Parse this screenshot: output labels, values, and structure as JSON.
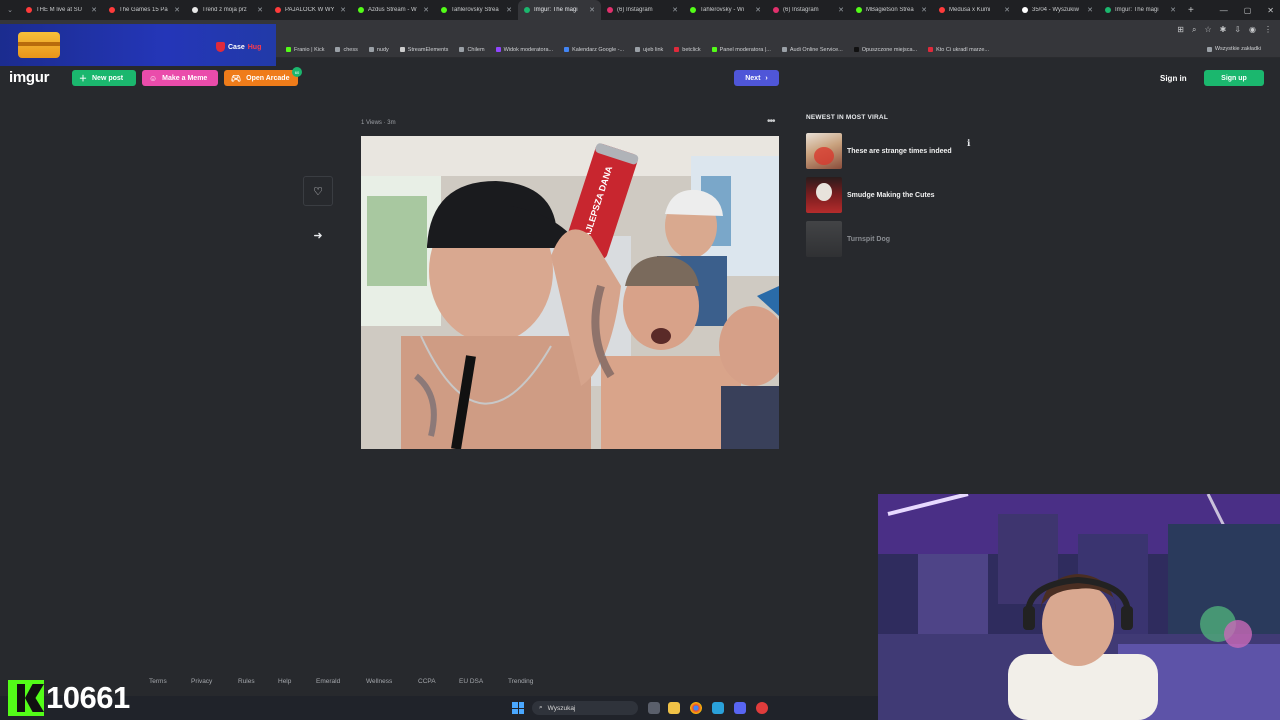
{
  "browser": {
    "tabs": [
      {
        "label": "THE M live at SU",
        "color": "#ff3b3b",
        "active": false
      },
      {
        "label": "The Games 15 Pa",
        "color": "#ff3b3b",
        "active": false
      },
      {
        "label": "Trend z moja prz",
        "color": "#e8e8e8",
        "active": false
      },
      {
        "label": "PAJALOCK W WY",
        "color": "#ff3b3b",
        "active": false
      },
      {
        "label": "Azdus Stream - W",
        "color": "#53fc18",
        "active": false
      },
      {
        "label": "Tahlerovsky Strea",
        "color": "#53fc18",
        "active": false
      },
      {
        "label": "Imgur: The magi",
        "color": "#1bb76e",
        "active": true
      },
      {
        "label": "(6) Instagram",
        "color": "#e1306c",
        "active": false
      },
      {
        "label": "Tahlerovsky - Wi",
        "color": "#53fc18",
        "active": false
      },
      {
        "label": "(6) Instagram",
        "color": "#e1306c",
        "active": false
      },
      {
        "label": "MBagietson Strea",
        "color": "#53fc18",
        "active": false
      },
      {
        "label": "Medusa x Kumi",
        "color": "#ff3b3b",
        "active": false
      },
      {
        "label": "35/04 - Wyszukiw",
        "color": "#ffffff",
        "active": false
      },
      {
        "label": "Imgur: The magi",
        "color": "#1bb76e",
        "active": false
      }
    ],
    "bookmarks": [
      {
        "label": "Franio | Kick",
        "color": "#53fc18"
      },
      {
        "label": "chess",
        "color": "#9aa0a6"
      },
      {
        "label": "nudy",
        "color": "#9aa0a6"
      },
      {
        "label": "StreamElements",
        "color": "#cccccc"
      },
      {
        "label": "Chilem",
        "color": "#9aa0a6"
      },
      {
        "label": "Widok moderatora...",
        "color": "#9146ff"
      },
      {
        "label": "Kalendarz Google -...",
        "color": "#4285f4"
      },
      {
        "label": "ujeb link",
        "color": "#9aa0a6"
      },
      {
        "label": "betclick",
        "color": "#e02a3b"
      },
      {
        "label": "Panel moderatora |...",
        "color": "#53fc18"
      },
      {
        "label": "Audi Online Service...",
        "color": "#9aa0a6"
      },
      {
        "label": "Opuszczone miejsca...",
        "color": "#111111"
      },
      {
        "label": "Kto Ci ukradl marze...",
        "color": "#e02a3b"
      }
    ],
    "all_bookmarks": "Wszystkie zakładki"
  },
  "overlay": {
    "case_brand": "Case",
    "case_brand_accent": "Hug"
  },
  "header": {
    "logo": "imgur",
    "new_post": "New post",
    "make_meme": "Make a Meme",
    "open_arcade": "Open Arcade",
    "arcade_badge": "60",
    "next": "Next",
    "sign_in": "Sign in",
    "sign_up": "Sign up"
  },
  "post": {
    "meta": "1 Views · 3m",
    "can_text": "NAJLEPSZA DANA"
  },
  "viral": {
    "title": "NEWEST IN MOST VIRAL",
    "items": [
      {
        "label": "These are strange times indeed",
        "dim": false
      },
      {
        "label": "Smudge Making the Cutes",
        "dim": false
      },
      {
        "label": "Turnspit Dog",
        "dim": true
      }
    ]
  },
  "footer": {
    "links": [
      "Terms",
      "Privacy",
      "Rules",
      "Help",
      "Emerald",
      "Wellness",
      "CCPA",
      "EU DSA",
      "Trending"
    ]
  },
  "taskbar": {
    "search": "Wyszukaj"
  },
  "kick": {
    "count": "10661"
  },
  "colors": {
    "imgur_green": "#1bb76e",
    "meme_pink": "#ea4cab",
    "arcade_orange": "#ef7c1a",
    "next_blue": "#4f56d8",
    "page_bg": "#27292d",
    "kick_green": "#53fc18"
  }
}
